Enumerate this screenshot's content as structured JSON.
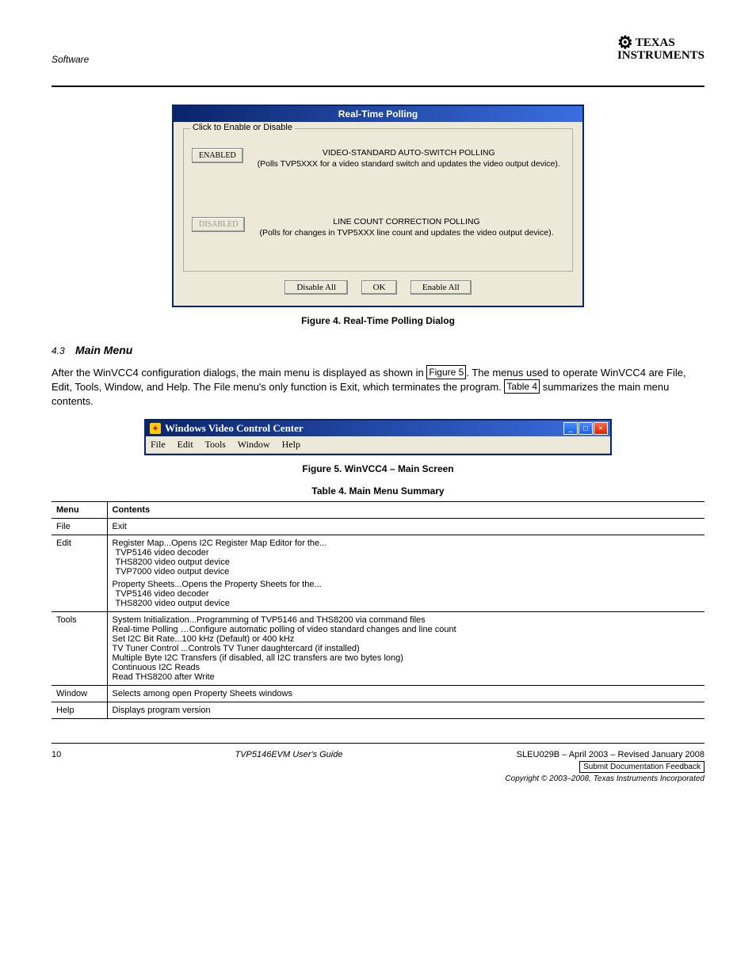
{
  "header": {
    "section_label": "Software",
    "brand_top": "TEXAS",
    "brand_bottom": "INSTRUMENTS"
  },
  "dialog_polling": {
    "title": "Real-Time Polling",
    "group_title": "Click to Enable or Disable",
    "row1": {
      "button": "ENABLED",
      "line1": "VIDEO-STANDARD AUTO-SWITCH POLLING",
      "line2": "(Polls TVP5XXX for a video standard switch and updates the video output device)."
    },
    "row2": {
      "button": "DISABLED",
      "line1": "LINE COUNT CORRECTION POLLING",
      "line2": "(Polls for changes in TVP5XXX line count and updates the video output device)."
    },
    "btn_disable": "Disable All",
    "btn_ok": "OK",
    "btn_enable": "Enable All"
  },
  "figure4_caption": "Figure 4. Real-Time Polling Dialog",
  "section_43": {
    "number": "4.3",
    "title": "Main Menu",
    "p1_a": "After the WinVCC4 configuration dialogs, the main menu is displayed as shown in ",
    "p1_link": "Figure 5",
    "p1_b": ". The menus used to operate WinVCC4 are File, Edit, Tools, Window, and Help. The File menu's only function is Exit, which terminates the program. ",
    "p1_link2": "Table 4",
    "p1_c": " summarizes the main menu contents."
  },
  "win2": {
    "title": "Windows Video Control Center",
    "menu": {
      "file": "File",
      "edit": "Edit",
      "tools": "Tools",
      "window": "Window",
      "help": "Help"
    }
  },
  "figure5_caption": "Figure 5. WinVCC4 – Main Screen",
  "table4_caption": "Table 4. Main Menu Summary",
  "table4": {
    "head": {
      "menu": "Menu",
      "contents": "Contents"
    },
    "r1": {
      "menu": "File",
      "content": "Exit"
    },
    "r2": {
      "menu": "Edit",
      "a": "Register Map...Opens I2C Register Map Editor for the...",
      "sub": [
        "TVP5146 video decoder",
        "THS8200 video output device",
        "TVP7000 video output device"
      ],
      "b": "Property Sheets...Opens the Property Sheets for the...",
      "sub2": [
        "TVP5146 video decoder",
        "THS8200 video output device"
      ]
    },
    "r3": {
      "menu": "Tools",
      "lines": [
        "System Initialization...Programming of TVP5146 and THS8200 via command files",
        "Real-time Polling …Configure automatic polling of video standard changes and line count",
        "Set I2C Bit Rate...100 kHz (Default) or 400 kHz",
        "TV Tuner Control ...Controls TV Tuner daughtercard (if installed)",
        "Multiple Byte I2C Transfers (if disabled, all I2C transfers are two bytes long)",
        "Continuous I2C Reads",
        "Read THS8200 after Write"
      ]
    },
    "r4": {
      "menu": "Window",
      "content": "Selects among open Property Sheets windows"
    },
    "r5": {
      "menu": "Help",
      "content": "Displays program version"
    }
  },
  "footer": {
    "page": "10",
    "doc_title": "TVP5146EVM User's Guide",
    "doc_code": "SLEU029B – April 2003 – Revised January 2008",
    "feedback": "Submit Documentation Feedback",
    "copyright": "Copyright © 2003–2008, Texas Instruments Incorporated"
  }
}
